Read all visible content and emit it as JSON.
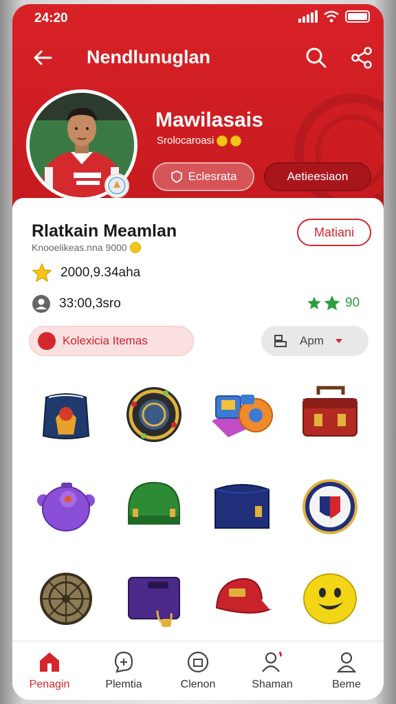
{
  "status": {
    "time": "24:20"
  },
  "topbar": {
    "title": "Nendlunuglan"
  },
  "profile": {
    "name": "Mawilasais",
    "subtitle": "Srolocaroasi",
    "button_light": "Eclesrata",
    "button_dark": "Aetieesiaon"
  },
  "card": {
    "title": "Rlatkain Meamlan",
    "subtitle": "Knooelikeas.nna",
    "subtitle_value": "9000",
    "action_button": "Matiani",
    "stat_one": "2000,9.34aha",
    "stat_two": "33:00,3sro",
    "stars_value": "90",
    "tab_label": "Kolexicia Itemas",
    "sort_label": "Apm"
  },
  "items": [
    {
      "icon": "backpack-icon",
      "color": "#1f3a6b"
    },
    {
      "icon": "badge-medal-icon",
      "color": "#2b2b2b"
    },
    {
      "icon": "toy-box-icon",
      "color": "#3b7bd4"
    },
    {
      "icon": "treasure-chest-icon",
      "color": "#a52a2a"
    },
    {
      "icon": "purple-pot-icon",
      "color": "#8a4fd6"
    },
    {
      "icon": "green-cap-icon",
      "color": "#2d8a35"
    },
    {
      "icon": "navy-case-icon",
      "color": "#1f2f7a"
    },
    {
      "icon": "club-crest-icon",
      "color": "#1f2f7a"
    },
    {
      "icon": "bronze-wheel-icon",
      "color": "#8c7a55"
    },
    {
      "icon": "purple-bag-icon",
      "color": "#4b2a8a"
    },
    {
      "icon": "red-cap-icon",
      "color": "#c8232a"
    },
    {
      "icon": "smiley-ball-icon",
      "color": "#f2d515"
    }
  ],
  "nav": [
    {
      "label": "Penagin",
      "icon": "home-icon",
      "active": true
    },
    {
      "label": "Plemtia",
      "icon": "chat-icon",
      "active": false
    },
    {
      "label": "Clenon",
      "icon": "clock-icon",
      "active": false
    },
    {
      "label": "Shaman",
      "icon": "people-icon",
      "active": false
    },
    {
      "label": "Beme",
      "icon": "profile-icon",
      "active": false
    }
  ],
  "colors": {
    "brand": "#d4262b",
    "brand_dark": "#a8161b",
    "star": "#f5c518",
    "green_star": "#2c9e3c"
  }
}
